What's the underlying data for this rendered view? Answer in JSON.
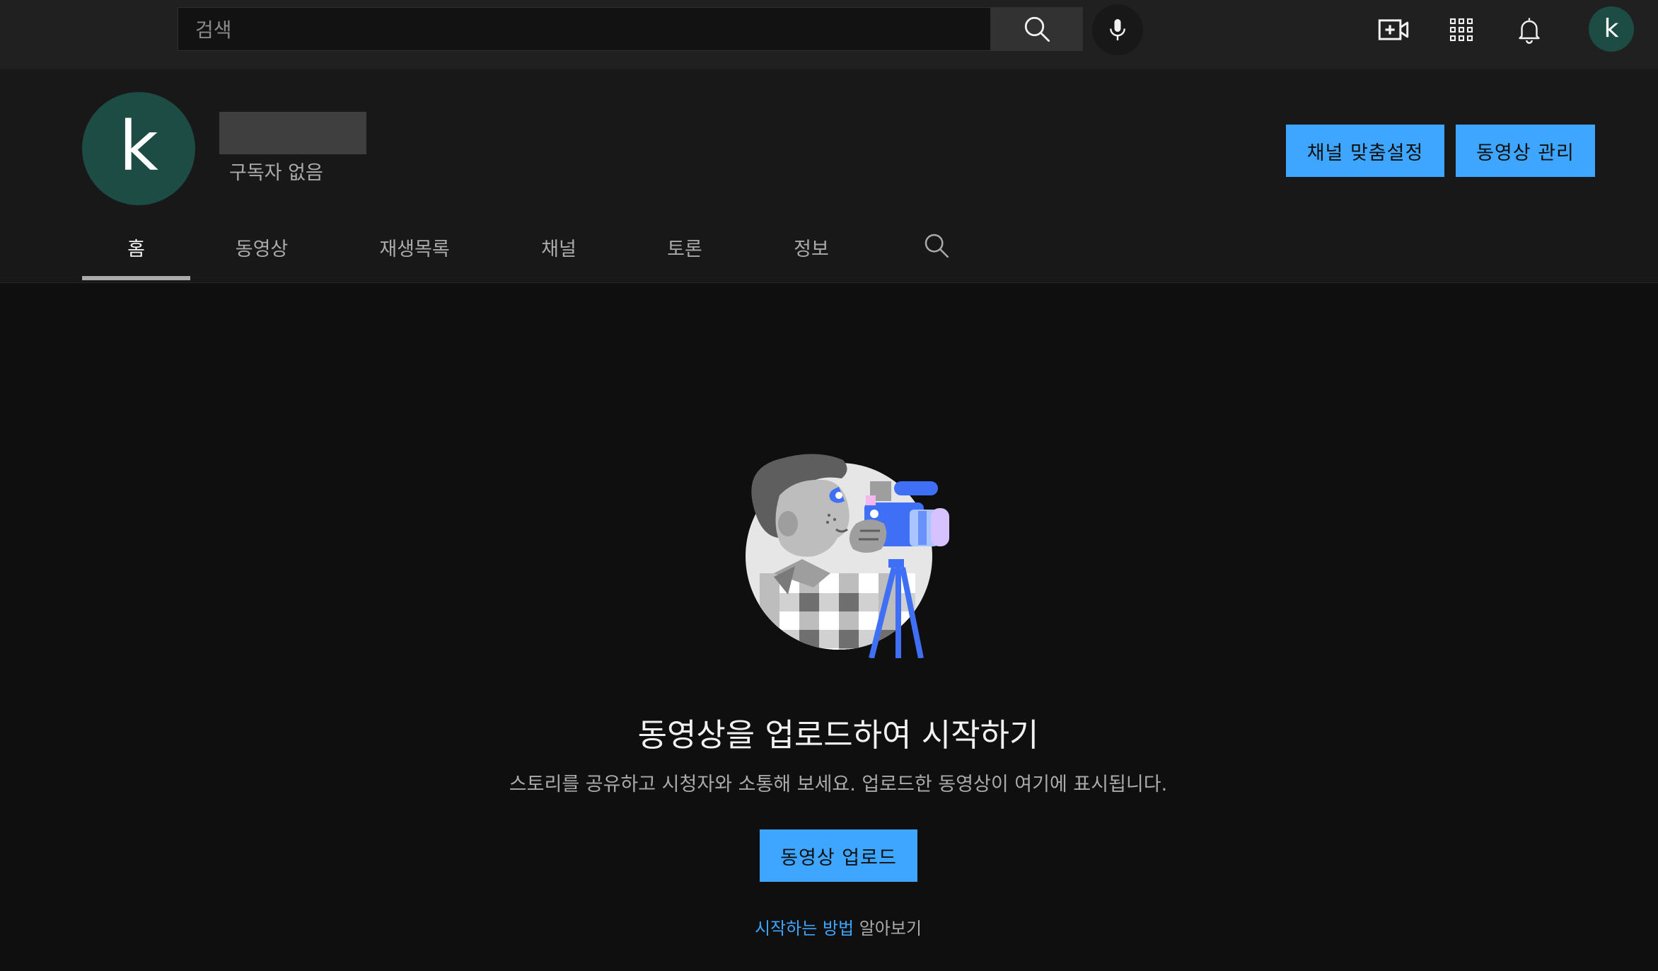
{
  "masthead": {
    "search_placeholder": "검색",
    "icons": [
      "search-icon",
      "microphone-icon",
      "create-video-icon",
      "apps-grid-icon",
      "notifications-bell-icon"
    ],
    "avatar_letter": "k",
    "avatar_color": "#1c4c43"
  },
  "channel": {
    "avatar_letter": "k",
    "subscriber_text": "구독자 없음",
    "customize_button": "채널 맞춤설정",
    "manage_button": "동영상 관리"
  },
  "tabs": [
    {
      "label": "홈",
      "active": true
    },
    {
      "label": "동영상",
      "active": false
    },
    {
      "label": "재생목록",
      "active": false
    },
    {
      "label": "채널",
      "active": false
    },
    {
      "label": "토론",
      "active": false
    },
    {
      "label": "정보",
      "active": false
    }
  ],
  "empty_state": {
    "title": "동영상을 업로드하여 시작하기",
    "description": "스토리를 공유하고 시청자와 소통해 보세요. 업로드한 동영상이 여기에 표시됩니다.",
    "upload_button": "동영상 업로드",
    "learn_link": "시작하는 방법",
    "learn_suffix": " 알아보기"
  },
  "colors": {
    "accent": "#3ea6ff",
    "background": "#0f0f0f",
    "header_bg": "#181818",
    "masthead_bg": "#202020"
  }
}
